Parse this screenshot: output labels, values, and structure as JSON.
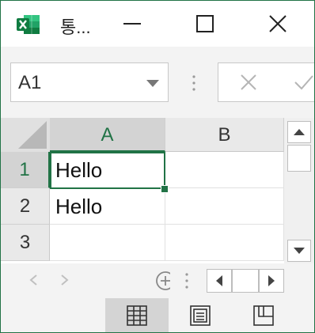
{
  "window": {
    "title": "통...",
    "app_icon": "excel-icon",
    "accent_color": "#217346"
  },
  "formula_bar": {
    "name_box": "A1",
    "cancel_icon": "close-icon",
    "enter_icon": "checkmark-icon"
  },
  "grid": {
    "columns": [
      "A",
      "B"
    ],
    "rows": [
      "1",
      "2",
      "3"
    ],
    "cells": [
      [
        "Hello",
        ""
      ],
      [
        "Hello",
        ""
      ],
      [
        "",
        ""
      ]
    ],
    "selected_cell": "A1"
  },
  "status_bar": {
    "views": [
      "normal-view-icon",
      "page-layout-icon",
      "page-break-preview-icon"
    ],
    "active_view": "normal-view-icon"
  }
}
